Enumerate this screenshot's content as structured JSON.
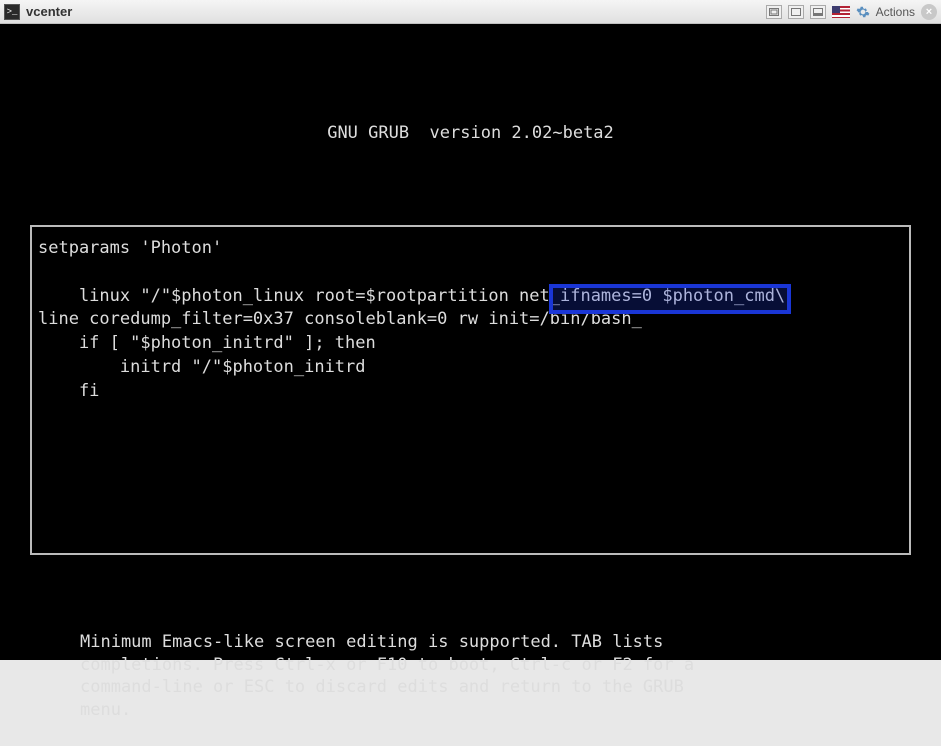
{
  "window": {
    "title": "vcenter",
    "actions_label": "Actions",
    "close_glyph": "×"
  },
  "grub": {
    "header": "GNU GRUB  version 2.02~beta2",
    "line1": "setparams 'Photon'",
    "blank": "",
    "line3_a": "    linux \"/\"$photon_linux root=$rootpartition",
    "line3_b": " net_ifnames=0 ",
    "line3_c": "$photon_cmd\\",
    "line4_a": "line coredump_filter=0x37 consoleblank=0 ",
    "line4_b": "rw init=/bin/bash_",
    "line5": "    if [ \"$photon_initrd\" ]; then",
    "line6": "        initrd \"/\"$photon_initrd",
    "line7": "    fi",
    "footer_l1": "Minimum Emacs-like screen editing is supported. TAB lists",
    "footer_l2": "completions. Press Ctrl-x or F10 to boot, Ctrl-c or F2 for a",
    "footer_l3": "command-line or ESC to discard edits and return to the GRUB",
    "footer_l4": "menu."
  }
}
